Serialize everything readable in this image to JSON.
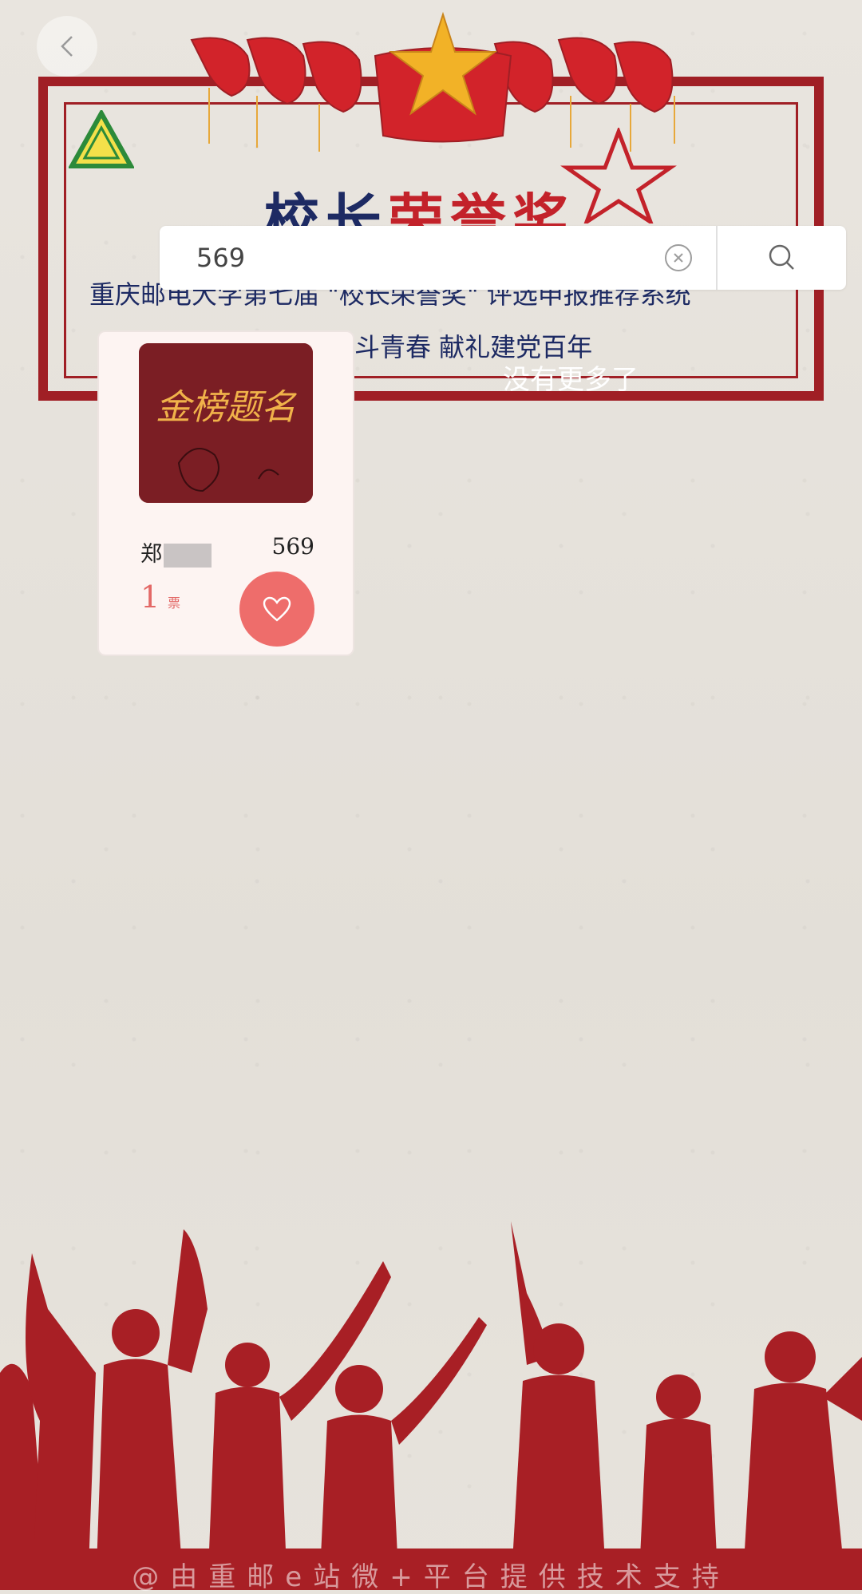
{
  "header": {
    "title_part1": "校长",
    "title_part2": "荣誉奖",
    "subtitle_line1": "重庆邮电大学第七届 \"校长荣誉奖\" 评选申报推荐系统",
    "subtitle_line2": "斗青春 献礼建党百年"
  },
  "search": {
    "value": "569",
    "placeholder": ""
  },
  "status": {
    "no_more": "没有更多了"
  },
  "cards": [
    {
      "image_text": "金榜题名",
      "name_visible": "郑",
      "id": "569",
      "votes": "1",
      "vote_unit": "票"
    }
  ],
  "footer": {
    "text": "@由重邮e站微+平台提供技术支持"
  },
  "colors": {
    "accent_red": "#a01f25",
    "like_button": "#ee6d6b",
    "title_blue": "#1d2a63"
  },
  "icons": {
    "back": "chevron-left-icon",
    "clear": "clear-icon",
    "search": "search-icon",
    "like": "heart-icon"
  }
}
